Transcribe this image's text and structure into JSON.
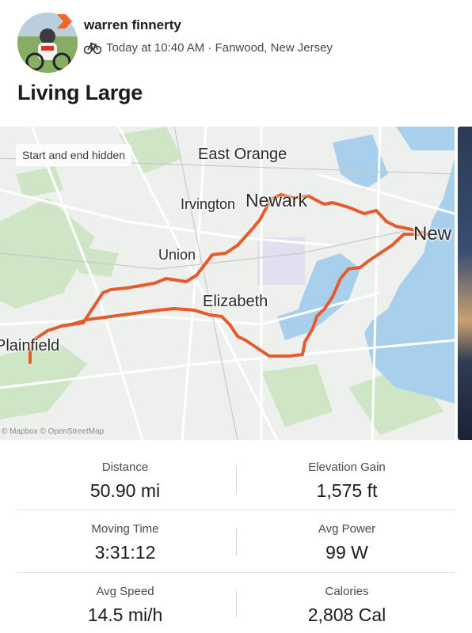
{
  "athlete": {
    "name": "warren finnerty",
    "meta": "Today at 10:40 AM · Fanwood, New Jersey",
    "activity_icon": "bicycle-icon"
  },
  "activity": {
    "title": "Living Large"
  },
  "map": {
    "hidden_label": "Start and end hidden",
    "attribution": "© Mapbox © OpenStreetMap",
    "places": {
      "east_orange": "East Orange",
      "irvington": "Irvington",
      "newark": "Newark",
      "union": "Union",
      "elizabeth": "Elizabeth",
      "plainfield": "Plainfield",
      "new": "New"
    },
    "route_color": "#e65a2c"
  },
  "stats": {
    "distance": {
      "label": "Distance",
      "value": "50.90 mi"
    },
    "elevation": {
      "label": "Elevation Gain",
      "value": "1,575 ft"
    },
    "moving_time": {
      "label": "Moving Time",
      "value": "3:31:12"
    },
    "power": {
      "label": "Avg Power",
      "value": "99 W"
    },
    "speed": {
      "label": "Avg Speed",
      "value": "14.5 mi/h"
    },
    "calories": {
      "label": "Calories",
      "value": "2,808 Cal"
    }
  }
}
